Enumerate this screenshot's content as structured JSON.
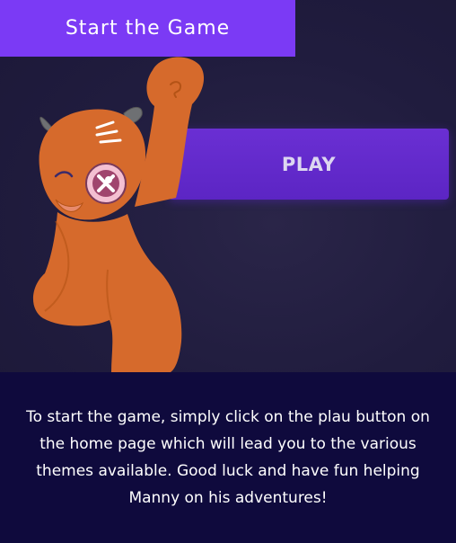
{
  "header": {
    "title": "Start the Game"
  },
  "hero": {
    "play_label": "PLAY",
    "mascot_icon": "manny-mascot-illustration",
    "colors": {
      "title_bar": "#7b3af5",
      "play_button": "#6a2fd3",
      "mascot": "#d66a2c"
    }
  },
  "info": {
    "text": "To start the game, simply click on the plau button on the home page which will lead you to the various themes available. Good luck and have fun helping Manny on his adventures!"
  }
}
